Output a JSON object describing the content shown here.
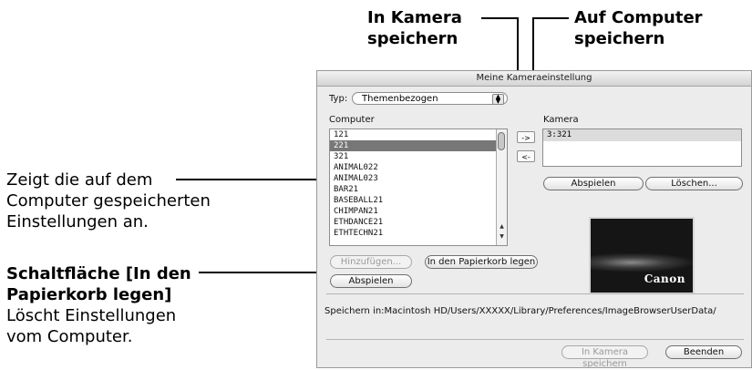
{
  "callouts": {
    "in_kamera_line1": "In Kamera",
    "in_kamera_line2": "speichern",
    "auf_computer_line1": "Auf Computer",
    "auf_computer_line2": "speichern",
    "zeigt_line1": "Zeigt die auf dem",
    "zeigt_line2": "Computer gespeicherten",
    "zeigt_line3": "Einstellungen an.",
    "papierkorb_line1": "Schaltfläche [In den",
    "papierkorb_line2": "Papierkorb legen]",
    "papierkorb_line3": "Löscht Einstellungen",
    "papierkorb_line4": "vom Computer."
  },
  "window": {
    "title": "Meine Kameraeinstellung",
    "type_label": "Typ:",
    "type_value": "Themenbezogen",
    "computer_label": "Computer",
    "camera_label": "Kamera",
    "computer_items": [
      "121",
      "221",
      "321",
      "ANIMAL022",
      "ANIMAL023",
      "BAR21",
      "BASEBALL21",
      "CHIMPAN21",
      "ETHDANCE21",
      "ETHTECHN21"
    ],
    "selected_index": 1,
    "camera_items": [
      "3:321"
    ],
    "to_camera_btn": "->",
    "to_computer_btn": "<-",
    "add_btn": "Hinzufügen...",
    "trash_btn": "In den Papierkorb legen",
    "play_left_btn": "Abspielen",
    "play_right_btn": "Abspielen",
    "delete_btn": "Löschen...",
    "preview_logo": "Canon",
    "save_path": "Speichern in:Macintosh HD/Users/XXXXX/Library/Preferences/ImageBrowserUserData/",
    "save_camera_btn": "In Kamera speichern",
    "quit_btn": "Beenden"
  }
}
